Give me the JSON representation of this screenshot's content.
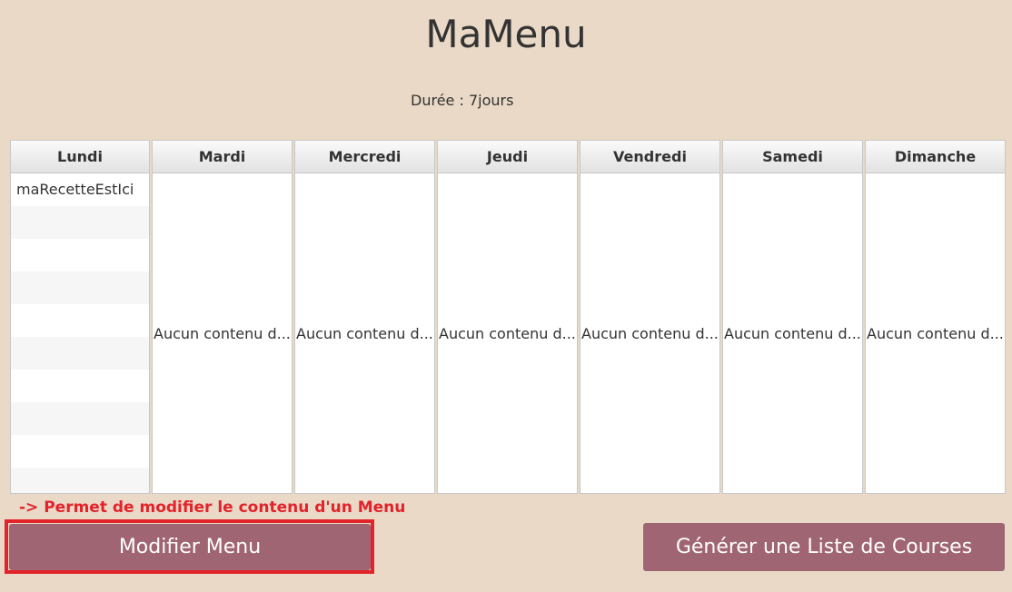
{
  "app": {
    "title": "MaMenu",
    "duration": "Durée : 7jours"
  },
  "table": {
    "columns": [
      {
        "label": "Lundi",
        "items": [
          "maRecetteEstIci"
        ],
        "empty_text": ""
      },
      {
        "label": "Mardi",
        "items": [],
        "empty_text": "Aucun contenu d..."
      },
      {
        "label": "Mercredi",
        "items": [],
        "empty_text": "Aucun contenu d..."
      },
      {
        "label": "Jeudi",
        "items": [],
        "empty_text": "Aucun contenu d..."
      },
      {
        "label": "Vendredi",
        "items": [],
        "empty_text": "Aucun contenu d..."
      },
      {
        "label": "Samedi",
        "items": [],
        "empty_text": "Aucun contenu d..."
      },
      {
        "label": "Dimanche",
        "items": [],
        "empty_text": "Aucun contenu d..."
      }
    ]
  },
  "annotation": {
    "text": "-> Permet de modifier le contenu d'un Menu",
    "color": "#e2232b"
  },
  "buttons": {
    "modify_label": "Modifier Menu",
    "generate_label": "Générer une Liste de Courses"
  },
  "colors": {
    "background": "#e9d9c6",
    "button": "#a06573",
    "highlight": "#e2232b"
  }
}
